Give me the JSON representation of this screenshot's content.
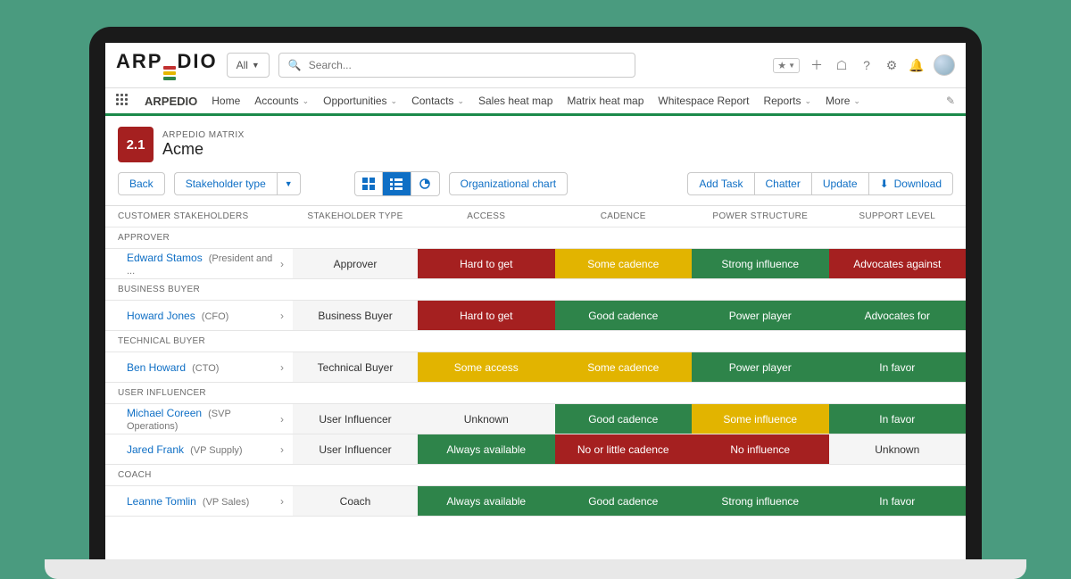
{
  "brand": "ARPEDIO",
  "search": {
    "scope": "All",
    "placeholder": "Search..."
  },
  "nav": {
    "app": "ARPEDIO",
    "items": [
      "Home",
      "Accounts",
      "Opportunities",
      "Contacts",
      "Sales heat map",
      "Matrix heat map",
      "Whitespace Report",
      "Reports",
      "More"
    ],
    "dropdowns": [
      false,
      true,
      true,
      true,
      false,
      false,
      false,
      true,
      true
    ]
  },
  "record": {
    "score": "2.1",
    "eyebrow": "ARPEDIO MATRIX",
    "title": "Acme"
  },
  "toolbar": {
    "back": "Back",
    "stakeholder_type": "Stakeholder type",
    "org_chart": "Organizational chart",
    "add_task": "Add Task",
    "chatter": "Chatter",
    "update": "Update",
    "download": "Download"
  },
  "columns": [
    "CUSTOMER STAKEHOLDERS",
    "STAKEHOLDER TYPE",
    "ACCESS",
    "CADENCE",
    "POWER STRUCTURE",
    "SUPPORT LEVEL"
  ],
  "groups": [
    {
      "label": "APPROVER",
      "rows": [
        {
          "name": "Edward Stamos",
          "role": "(President and ...",
          "type": "Approver",
          "access": {
            "text": "Hard to get",
            "c": "red"
          },
          "cadence": {
            "text": "Some cadence",
            "c": "yellow"
          },
          "power": {
            "text": "Strong influence",
            "c": "green"
          },
          "support": {
            "text": "Advocates against",
            "c": "red"
          }
        }
      ]
    },
    {
      "label": "BUSINESS BUYER",
      "rows": [
        {
          "name": "Howard Jones",
          "role": "(CFO)",
          "type": "Business Buyer",
          "access": {
            "text": "Hard to get",
            "c": "red"
          },
          "cadence": {
            "text": "Good cadence",
            "c": "green"
          },
          "power": {
            "text": "Power player",
            "c": "green"
          },
          "support": {
            "text": "Advocates for",
            "c": "green"
          }
        }
      ]
    },
    {
      "label": "TECHNICAL BUYER",
      "rows": [
        {
          "name": "Ben Howard",
          "role": "(CTO)",
          "type": "Technical Buyer",
          "access": {
            "text": "Some access",
            "c": "yellow"
          },
          "cadence": {
            "text": "Some cadence",
            "c": "yellow"
          },
          "power": {
            "text": "Power player",
            "c": "green"
          },
          "support": {
            "text": "In favor",
            "c": "green"
          }
        }
      ]
    },
    {
      "label": "USER INFLUENCER",
      "rows": [
        {
          "name": "Michael Coreen",
          "role": "(SVP Operations)",
          "type": "User Influencer",
          "access": {
            "text": "Unknown",
            "c": "grey"
          },
          "cadence": {
            "text": "Good cadence",
            "c": "green"
          },
          "power": {
            "text": "Some influence",
            "c": "yellow"
          },
          "support": {
            "text": "In favor",
            "c": "green"
          }
        },
        {
          "name": "Jared Frank",
          "role": "(VP Supply)",
          "type": "User Influencer",
          "access": {
            "text": "Always available",
            "c": "green"
          },
          "cadence": {
            "text": "No or little cadence",
            "c": "red"
          },
          "power": {
            "text": "No influence",
            "c": "red"
          },
          "support": {
            "text": "Unknown",
            "c": "grey"
          }
        }
      ]
    },
    {
      "label": "COACH",
      "rows": [
        {
          "name": "Leanne Tomlin",
          "role": "(VP Sales)",
          "type": "Coach",
          "access": {
            "text": "Always available",
            "c": "green"
          },
          "cadence": {
            "text": "Good cadence",
            "c": "green"
          },
          "power": {
            "text": "Strong influence",
            "c": "green"
          },
          "support": {
            "text": "In favor",
            "c": "green"
          }
        }
      ]
    }
  ]
}
